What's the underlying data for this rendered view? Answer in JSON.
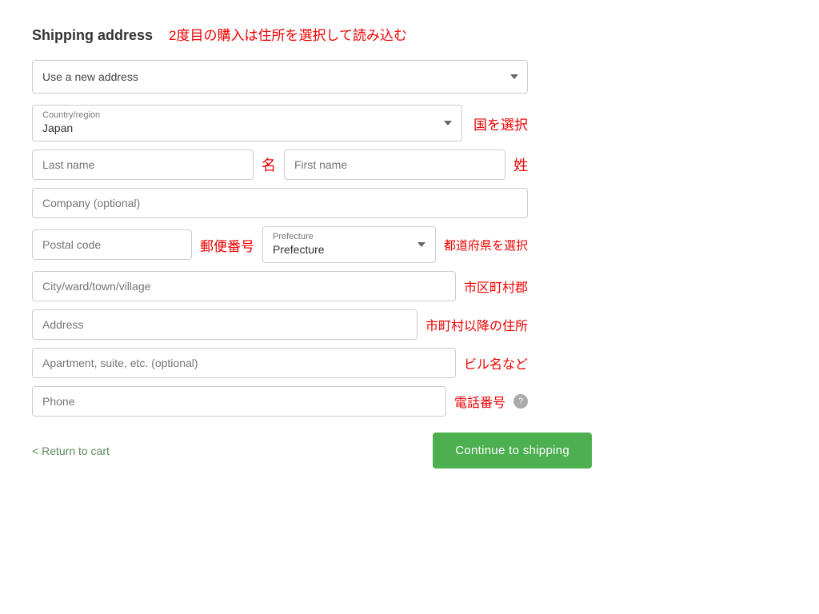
{
  "header": {
    "title": "Shipping address",
    "annotation": "2度目の購入は住所を選択して読み込む"
  },
  "address_selector": {
    "options": [
      "Use a new address"
    ],
    "selected": "Use a new address"
  },
  "country_field": {
    "label": "Country/region",
    "value": "Japan",
    "annotation": "国を選択"
  },
  "last_name": {
    "placeholder": "Last name",
    "annotation": "名"
  },
  "first_name": {
    "placeholder": "First name",
    "annotation": "姓"
  },
  "company": {
    "placeholder": "Company (optional)"
  },
  "postal_code": {
    "placeholder": "Postal code",
    "annotation": "郵便番号"
  },
  "prefecture": {
    "label": "Prefecture",
    "value": "Prefecture",
    "annotation": "都道府県を選択"
  },
  "city": {
    "placeholder": "City/ward/town/village",
    "annotation": "市区町村郡"
  },
  "address": {
    "placeholder": "Address",
    "annotation": "市町村以降の住所"
  },
  "apartment": {
    "placeholder": "Apartment, suite, etc. (optional)",
    "annotation": "ビル名など"
  },
  "phone": {
    "placeholder": "Phone",
    "annotation": "電話番号"
  },
  "footer": {
    "return_link": "Return to cart",
    "continue_button": "Continue to shipping"
  }
}
